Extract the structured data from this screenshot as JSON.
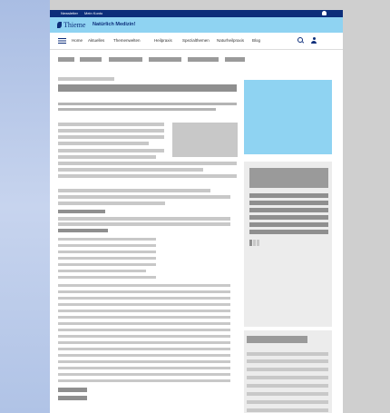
{
  "topbar": {
    "links": [
      "Newsletter",
      "Mein Konto"
    ]
  },
  "brand": {
    "name": "Thieme",
    "subtitle": "Natürlich Medizin!"
  },
  "nav": {
    "items": [
      "Home",
      "Aktuelles",
      "Themenwelten",
      "Heilpraxis",
      "Spezialthemen",
      "Naturheilpraxis",
      "Blog"
    ]
  },
  "colors": {
    "navy": "#0c2e7a",
    "sky": "#8fd3f2"
  },
  "icons": [
    "menu-icon",
    "search-icon",
    "account-icon",
    "leaf-icon",
    "user-icon"
  ]
}
